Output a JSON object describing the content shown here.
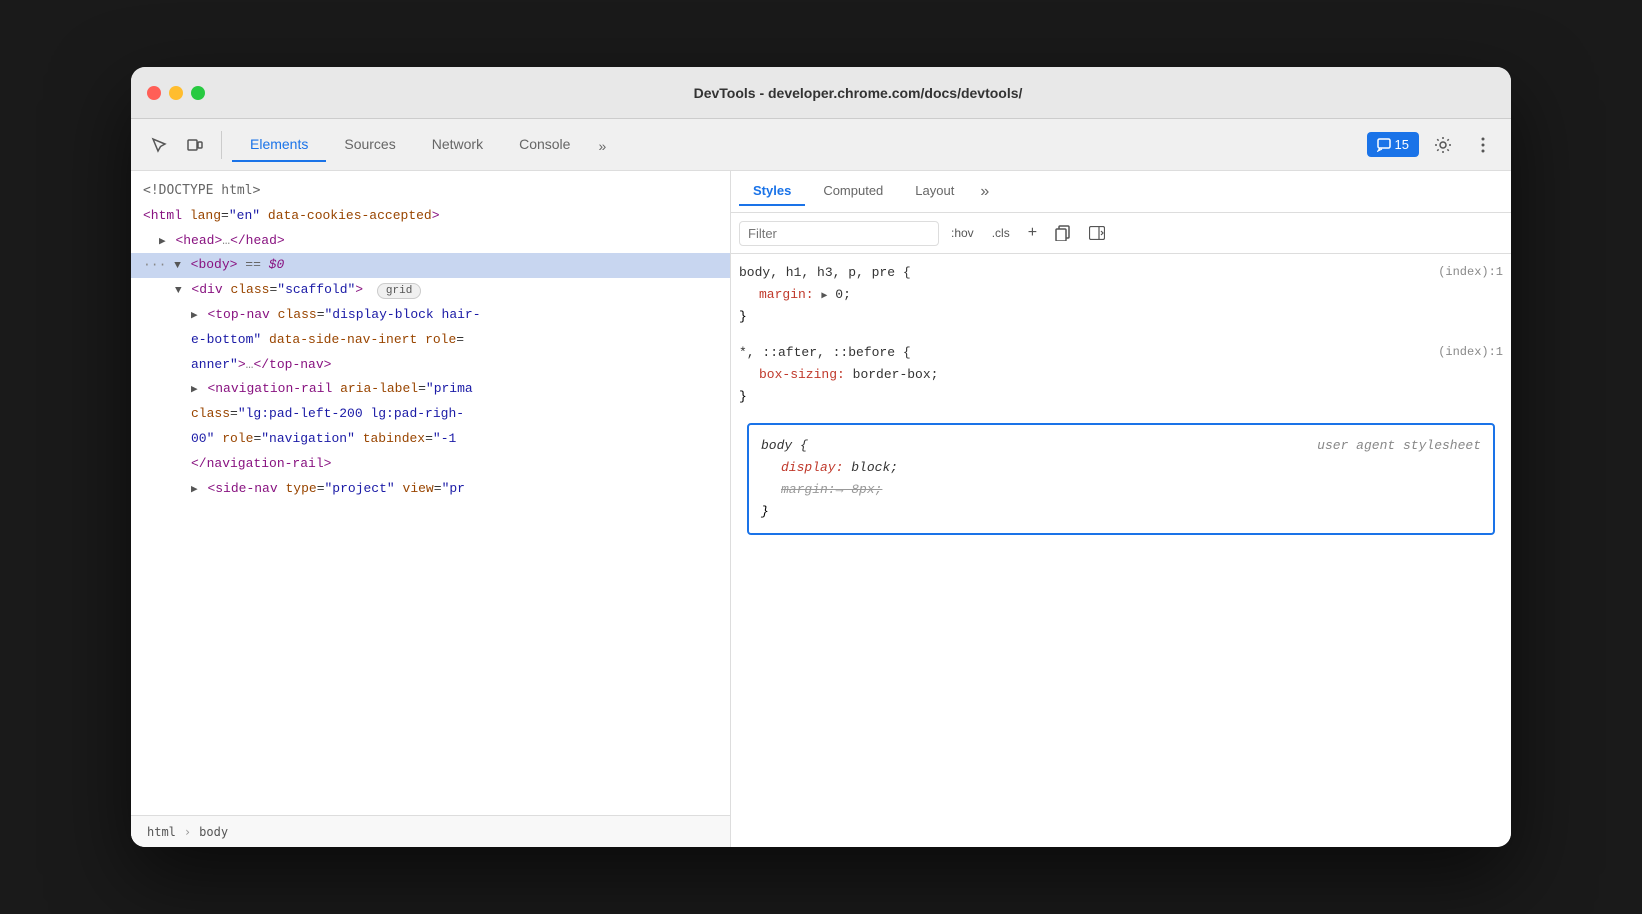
{
  "window": {
    "title": "DevTools - developer.chrome.com/docs/devtools/"
  },
  "tabs": {
    "items": [
      "Elements",
      "Sources",
      "Network",
      "Console"
    ],
    "active": "Elements"
  },
  "toolbar": {
    "messages_count": "15",
    "messages_label": "15"
  },
  "elements_panel": {
    "lines": [
      {
        "id": "doctype",
        "text": "<!DOCTYPE html>",
        "type": "doctype",
        "indent": 0
      },
      {
        "id": "html",
        "text": "<html lang=\"en\" data-cookies-accepted>",
        "type": "html",
        "indent": 0
      },
      {
        "id": "head",
        "text": "▶ <head>…</head>",
        "type": "collapsed",
        "indent": 1
      },
      {
        "id": "body",
        "text": "··· ▼ <body> == $0",
        "type": "selected",
        "indent": 1
      },
      {
        "id": "div-scaffold",
        "text": "▼ <div class=\"scaffold\">",
        "badge": "grid",
        "type": "open",
        "indent": 2
      },
      {
        "id": "top-nav",
        "text": "▶ <top-nav class=\"display-block hair-",
        "type": "open",
        "indent": 3
      },
      {
        "id": "top-nav2",
        "text": "e-bottom\" data-side-nav-inert role=",
        "type": "continuation",
        "indent": 3
      },
      {
        "id": "top-nav3",
        "text": "anner\">…</top-nav>",
        "type": "continuation",
        "indent": 3
      },
      {
        "id": "nav-rail",
        "text": "▶ <navigation-rail aria-label=\"prima",
        "type": "open",
        "indent": 3
      },
      {
        "id": "nav-rail2",
        "text": "class=\"lg:pad-left-200 lg:pad-righ-",
        "type": "continuation",
        "indent": 3
      },
      {
        "id": "nav-rail3",
        "text": "00\" role=\"navigation\" tabindex=\"-1",
        "type": "continuation",
        "indent": 3
      },
      {
        "id": "nav-rail4",
        "text": "</navigation-rail>",
        "type": "close",
        "indent": 3
      },
      {
        "id": "side-nav",
        "text": "▶ <side-nav type=\"project\" view=\"pr",
        "type": "open",
        "indent": 3
      }
    ]
  },
  "breadcrumb": {
    "items": [
      "html",
      "body"
    ]
  },
  "styles_panel": {
    "tabs": [
      "Styles",
      "Computed",
      "Layout"
    ],
    "active": "Styles"
  },
  "filter": {
    "placeholder": "Filter",
    "buttons": [
      ":hov",
      ".cls",
      "+"
    ]
  },
  "css_rules": [
    {
      "id": "rule1",
      "selector": "body, h1, h3, p, pre {",
      "source": "(index):1",
      "properties": [
        {
          "prop": "margin:",
          "triangle": "▶",
          "value": "0",
          "end": ";"
        }
      ],
      "close": "}"
    },
    {
      "id": "rule2",
      "selector": "*, ::after, ::before {",
      "source": "(index):1",
      "properties": [
        {
          "prop": "box-sizing:",
          "value": "border-box",
          "end": ";"
        }
      ],
      "close": "}"
    },
    {
      "id": "rule3_highlighted",
      "selector": "body {",
      "comment": "user agent stylesheet",
      "properties": [
        {
          "prop": "display:",
          "value": "block",
          "end": ";",
          "italic": true
        },
        {
          "prop": "margin:",
          "value": "8px",
          "end": ";",
          "strikethrough": true,
          "italic": true
        }
      ],
      "close": "}"
    }
  ]
}
